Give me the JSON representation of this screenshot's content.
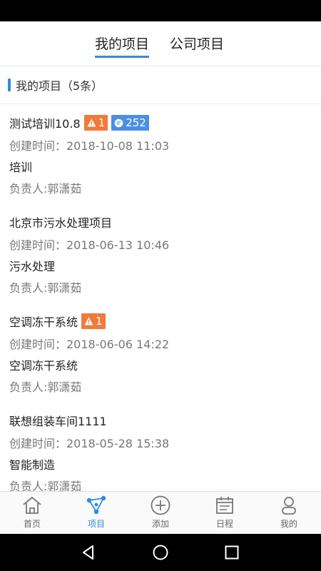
{
  "tabs": [
    {
      "label": "我的项目",
      "active": true
    },
    {
      "label": "公司项目",
      "active": false
    }
  ],
  "section": {
    "title": "我的项目（5条）"
  },
  "projects": [
    {
      "name": "测试培训10.8",
      "created": "创建时间：2018-10-08 11:03",
      "category": "培训",
      "owner": "负责人:郭潇茹",
      "warn": "1",
      "messages": "252"
    },
    {
      "name": "北京市污水处理项目",
      "created": "创建时间：2018-06-13 10:46",
      "category": "污水处理",
      "owner": "负责人:郭潇茹"
    },
    {
      "name": "空调冻干系统",
      "created": "创建时间：2018-06-06 14:22",
      "category": "空调冻干系统",
      "owner": "负责人:郭潇茹",
      "warn": "1"
    },
    {
      "name": "联想组装车间1111",
      "created": "创建时间：2018-05-28 15:38",
      "category": "智能制造",
      "owner": "负责人:郭潇茹"
    }
  ],
  "bottom_nav": [
    {
      "label": "首页",
      "icon": "home-icon"
    },
    {
      "label": "项目",
      "icon": "project-network-icon",
      "active": true
    },
    {
      "label": "添加",
      "icon": "add-circle-icon"
    },
    {
      "label": "日程",
      "icon": "calendar-icon"
    },
    {
      "label": "我的",
      "icon": "user-icon"
    }
  ],
  "colors": {
    "accent": "#2f8be0",
    "warn_badge": "#f07a3a",
    "message_badge": "#4a90e2"
  }
}
